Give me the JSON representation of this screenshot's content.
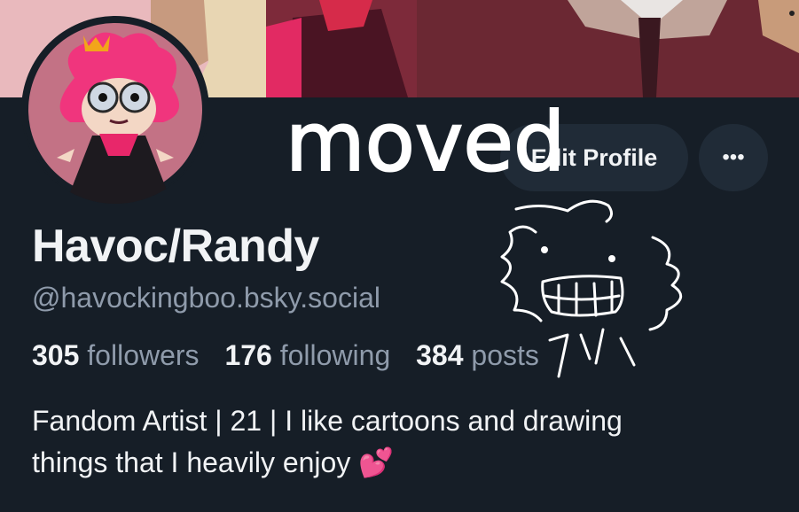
{
  "profile": {
    "display_name": "Havoc/Randy",
    "handle": "@havockingboo.bsky.social",
    "bio_line1": "Fandom Artist | 21 | I like cartoons and drawing",
    "bio_line2": "things that I heavily enjoy",
    "bio_emoji": "💕"
  },
  "stats": {
    "followers_count": "305",
    "followers_label": "followers",
    "following_count": "176",
    "following_label": "following",
    "posts_count": "384",
    "posts_label": "posts"
  },
  "actions": {
    "edit_profile_label": "Edit Profile",
    "more_label": "•••"
  },
  "annotation": {
    "scribble_text": "moved"
  },
  "colors": {
    "background": "#161e27",
    "button_bg": "#202b37",
    "primary_text": "#f1f3f5",
    "secondary_text": "#8f9bab",
    "heart_pink": "#ff4fa3"
  }
}
